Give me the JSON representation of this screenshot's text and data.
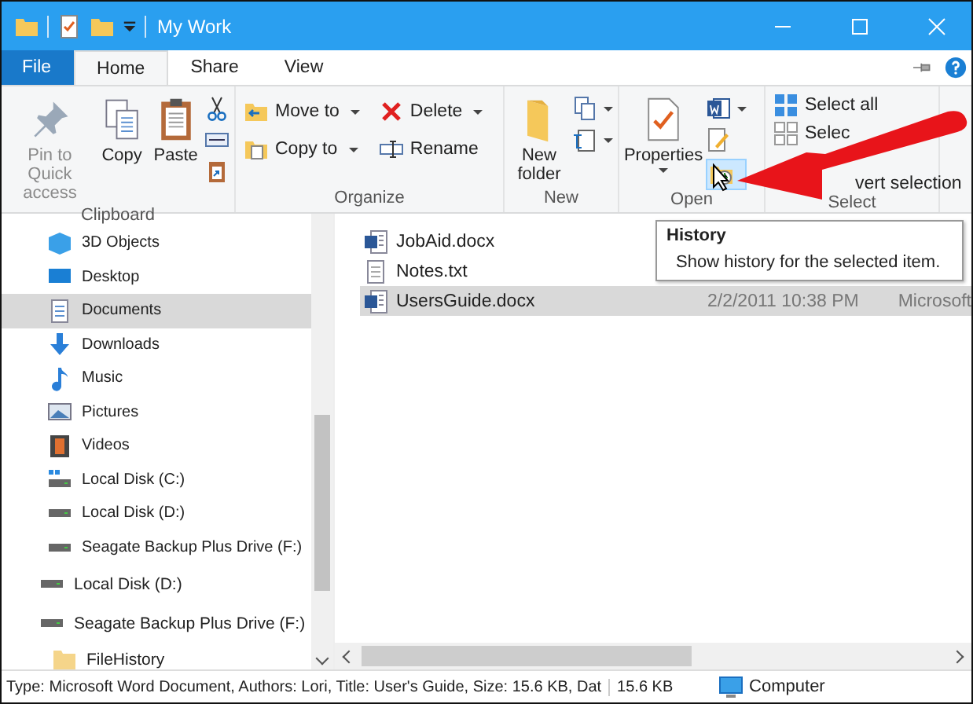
{
  "window": {
    "title": "My Work"
  },
  "ribbon_tabs": [
    {
      "label": "File",
      "kind": "file",
      "selected": false
    },
    {
      "label": "Home",
      "kind": "tab",
      "selected": true
    },
    {
      "label": "Share",
      "kind": "tab",
      "selected": false
    },
    {
      "label": "View",
      "kind": "tab",
      "selected": false
    }
  ],
  "ribbon": {
    "clipboard": {
      "label": "Clipboard",
      "pin": {
        "label": "Pin to Quick access",
        "disabled": true
      },
      "copy": "Copy",
      "paste": "Paste"
    },
    "organize": {
      "label": "Organize",
      "move_to": "Move to",
      "copy_to": "Copy to",
      "delete": "Delete",
      "rename": "Rename"
    },
    "new": {
      "label": "New",
      "new_folder": "New folder"
    },
    "open": {
      "label": "Open",
      "properties": "Properties",
      "history_hovered": true
    },
    "select": {
      "label": "Select",
      "select_all": "Select all",
      "select_none": "Selec",
      "invert_selection": "vert selection"
    }
  },
  "navigation": {
    "this_pc_items": [
      {
        "label": "3D Objects",
        "kind": "objects",
        "selected": false
      },
      {
        "label": "Desktop",
        "kind": "desktop",
        "selected": false
      },
      {
        "label": "Documents",
        "kind": "documents",
        "selected": true
      },
      {
        "label": "Downloads",
        "kind": "downloads",
        "selected": false
      },
      {
        "label": "Music",
        "kind": "music",
        "selected": false
      },
      {
        "label": "Pictures",
        "kind": "pictures",
        "selected": false
      },
      {
        "label": "Videos",
        "kind": "videos",
        "selected": false
      },
      {
        "label": "Local Disk (C:)",
        "kind": "system-drive",
        "selected": false
      },
      {
        "label": "Local Disk (D:)",
        "kind": "drive",
        "selected": false
      },
      {
        "label": "Seagate Backup Plus Drive (F:)",
        "kind": "drive",
        "selected": false
      }
    ],
    "drives": [
      {
        "label": "Local Disk (D:)",
        "kind": "drive",
        "selected": false
      },
      {
        "label": "Seagate Backup Plus Drive (F:)",
        "kind": "drive",
        "selected": false,
        "children": [
          {
            "label": "FileHistory",
            "kind": "folder",
            "selected": false
          }
        ]
      }
    ]
  },
  "files": [
    {
      "name": "JobAid.docx",
      "kind": "word",
      "selected": false
    },
    {
      "name": "Notes.txt",
      "kind": "text",
      "selected": false
    },
    {
      "name": "UsersGuide.docx",
      "kind": "word",
      "selected": true,
      "date": "2/2/2011 10:38 PM",
      "type": "Microsoft"
    }
  ],
  "tooltip": {
    "title": "History",
    "text": "Show history for the selected item."
  },
  "status_bar": {
    "details": "Type: Microsoft Word Document, Authors: Lori, Title: User's Guide, Size: 15.6 KB, Dat",
    "size": "15.6 KB",
    "location": "Computer"
  }
}
